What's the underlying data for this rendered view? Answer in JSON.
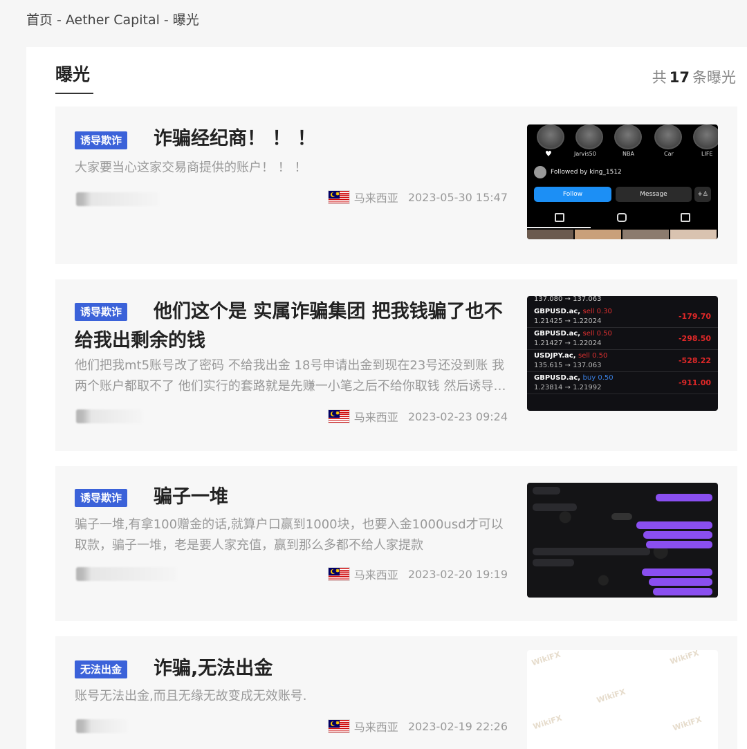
{
  "breadcrumb": {
    "home": "首页",
    "broker": "Aether Capital",
    "current": "曝光",
    "separator": "-"
  },
  "header": {
    "title": "曝光",
    "total_prefix": "共",
    "total_count": "17",
    "total_suffix": "条曝光"
  },
  "colors": {
    "tag_blue": "#3b62d9",
    "card_bg": "#f7f7f7",
    "page_bg": "#f6f6f6",
    "text_muted": "#999999"
  },
  "cards": [
    {
      "tag": "诱导欺诈",
      "title": "诈骗经纪商！ ！ ！",
      "desc": "大家要当心这家交易商提供的账户！ ！ ！",
      "country": "马来西亚",
      "flag_icon": "malaysia-flag-icon",
      "datetime": "2023-05-30 15:47",
      "thumb": {
        "stories": [
          "",
          "Jarvis50",
          "NBA",
          "Car",
          "LIFE"
        ],
        "followed_by": "Followed by king_1512",
        "follow": "Follow",
        "message": "Message",
        "add": "+♙"
      }
    },
    {
      "tag": "诱导欺诈",
      "title": "他们这个是 实属诈骗集团 把我钱骗了也不给我出剩余的钱",
      "desc": "他们把我mt5账号改了密码 不给我出金 18号申请出金到现在23号还没到账 我两个账户都取不了 他们实行的套路就是先赚一小笔之后不给你取钱 然后诱导你入金",
      "country": "马来西亚",
      "flag_icon": "malaysia-flag-icon",
      "datetime": "2023-02-23 09:24",
      "thumb": {
        "top_prices": "137.080 → 137.063",
        "trades": [
          {
            "symbol": "GBPUSD.ac,",
            "side": "sell 0.30",
            "prices": "1.21425 → 1.22024",
            "pnl": "-179.70"
          },
          {
            "symbol": "GBPUSD.ac,",
            "side": "sell 0.50",
            "prices": "1.21427 → 1.22024",
            "pnl": "-298.50"
          },
          {
            "symbol": "USDJPY.ac,",
            "side": "sell 0.50",
            "prices": "135.615 → 137.063",
            "pnl": "-528.22"
          },
          {
            "symbol": "GBPUSD.ac,",
            "side": "buy 0.50",
            "prices": "1.23814 → 1.21992",
            "pnl": "-911.00"
          }
        ]
      }
    },
    {
      "tag": "诱导欺诈",
      "title": "骗子一堆",
      "desc": "骗子一堆,有拿100赠金的话,就算户口赢到1000块，也要入金1000usd才可以取款，骗子一堆，老是要人家充值，赢到那么多都不给人家提款",
      "country": "马来西亚",
      "flag_icon": "malaysia-flag-icon",
      "datetime": "2023-02-20 19:19",
      "thumb": {}
    },
    {
      "tag": "无法出金",
      "title": "诈骗,无法出金",
      "desc": "账号无法出金,而且无缘无故变成无效账号.",
      "country": "马来西亚",
      "flag_icon": "malaysia-flag-icon",
      "datetime": "2023-02-19 22:26",
      "thumb": {
        "watermark": "WikiFX"
      }
    }
  ]
}
